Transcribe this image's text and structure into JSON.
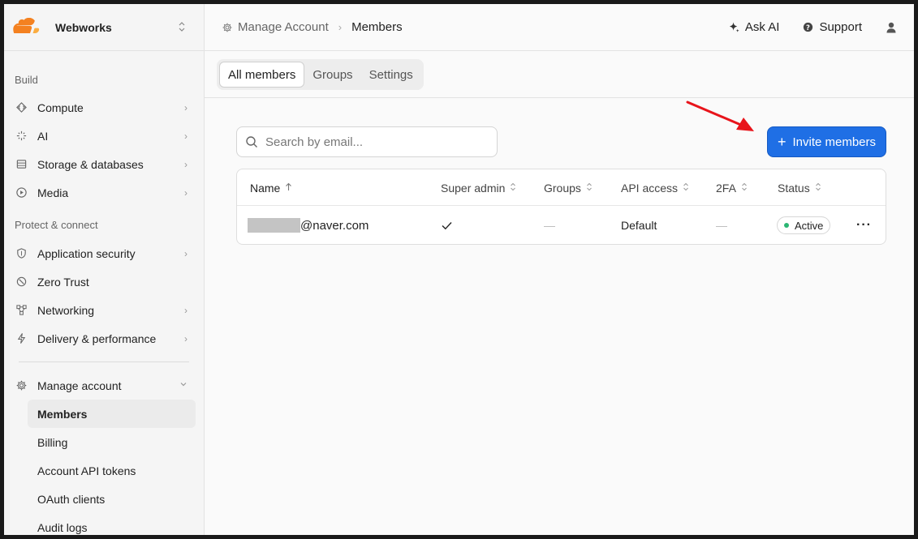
{
  "sidebar": {
    "account_name": "Webworks",
    "sections": {
      "build": "Build",
      "protect": "Protect & connect"
    },
    "build_items": [
      {
        "label": "Compute"
      },
      {
        "label": "AI"
      },
      {
        "label": "Storage & databases"
      },
      {
        "label": "Media"
      }
    ],
    "protect_items": [
      {
        "label": "Application security"
      },
      {
        "label": "Zero Trust"
      },
      {
        "label": "Networking"
      },
      {
        "label": "Delivery & performance"
      }
    ],
    "manage": {
      "label": "Manage account",
      "children": [
        {
          "label": "Members"
        },
        {
          "label": "Billing"
        },
        {
          "label": "Account API tokens"
        },
        {
          "label": "OAuth clients"
        },
        {
          "label": "Audit logs"
        }
      ]
    }
  },
  "topbar": {
    "breadcrumb_parent": "Manage Account",
    "breadcrumb_current": "Members",
    "ask_ai": "Ask AI",
    "support": "Support"
  },
  "tabs": [
    {
      "label": "All members"
    },
    {
      "label": "Groups"
    },
    {
      "label": "Settings"
    }
  ],
  "search": {
    "placeholder": "Search by email..."
  },
  "invite_button": "Invite members",
  "table": {
    "headers": [
      "Name",
      "Super admin",
      "Groups",
      "API access",
      "2FA",
      "Status"
    ],
    "rows": [
      {
        "email_domain": "@naver.com",
        "super_admin": "✓",
        "groups": "—",
        "api_access": "Default",
        "twofa": "—",
        "status": "Active"
      }
    ]
  },
  "colors": {
    "accent": "#1f6fe5",
    "brand": "#f48120",
    "status_active": "#2bb673",
    "annotation": "#e8141b"
  }
}
